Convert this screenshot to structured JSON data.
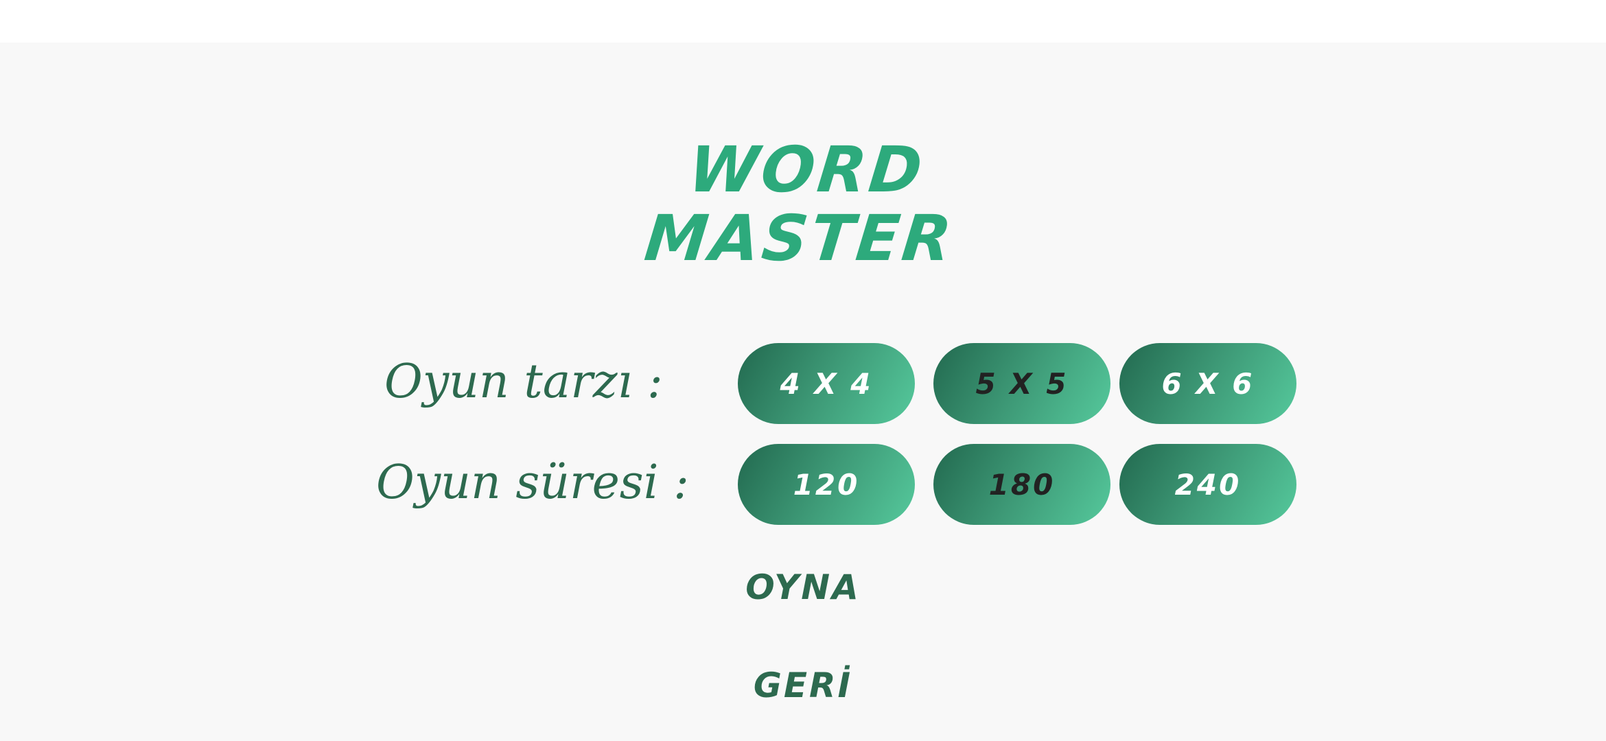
{
  "app": {
    "logo_line1": "WORD",
    "logo_line2": "MASTER"
  },
  "game_mode": {
    "label": "Oyun tarzı :",
    "options": [
      {
        "label": "4 X 4",
        "selected": false
      },
      {
        "label": "5 X 5",
        "selected": true
      },
      {
        "label": "6 X 6",
        "selected": false
      }
    ]
  },
  "game_time": {
    "label": "Oyun süresi :",
    "options": [
      {
        "label": "120",
        "selected": false
      },
      {
        "label": "180",
        "selected": true
      },
      {
        "label": "240",
        "selected": false
      }
    ]
  },
  "actions": {
    "play_label": "OYNA",
    "back_label": "GERİ"
  },
  "colors": {
    "brand": "#2daa7c",
    "label_text": "#2d6a4f",
    "button_gradient_start": "#22694f",
    "button_gradient_end": "#55c99c",
    "selected_text": "#222222",
    "unselected_text": "#ffffff"
  }
}
